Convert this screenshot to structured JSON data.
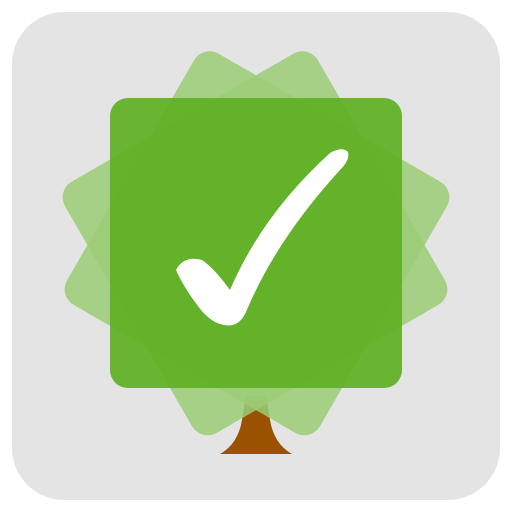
{
  "icon": {
    "name": "tree-checkmark-app-icon",
    "colors": {
      "background_tile": "#e4e4e4",
      "leaf_light": "#9bcd75",
      "leaf_mid": "#7dbe50",
      "leaf_main": "#5fb024",
      "trunk": "#9a5200",
      "checkmark": "#ffffff"
    }
  }
}
